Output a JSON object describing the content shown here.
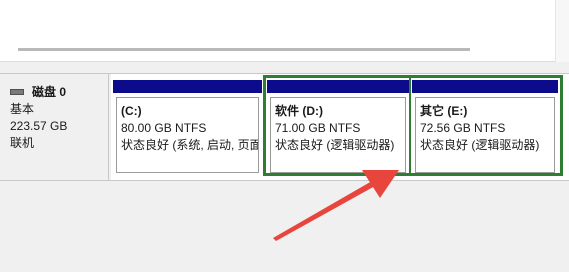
{
  "disk": {
    "name": "磁盘 0",
    "type": "基本",
    "size": "223.57 GB",
    "status": "联机"
  },
  "partitions": [
    {
      "name": "(C:)",
      "size": "80.00 GB NTFS",
      "status": "状态良好 (系统, 启动, 页面"
    },
    {
      "name": "软件  (D:)",
      "size": "71.00 GB NTFS",
      "status": "状态良好 (逻辑驱动器)"
    },
    {
      "name": "其它  (E:)",
      "size": "72.56 GB NTFS",
      "status": "状态良好 (逻辑驱动器)"
    }
  ],
  "colors": {
    "partition_bar": "#0b0b8c",
    "selection_outline": "#2e7d32",
    "annotation_arrow": "#e8453c"
  }
}
